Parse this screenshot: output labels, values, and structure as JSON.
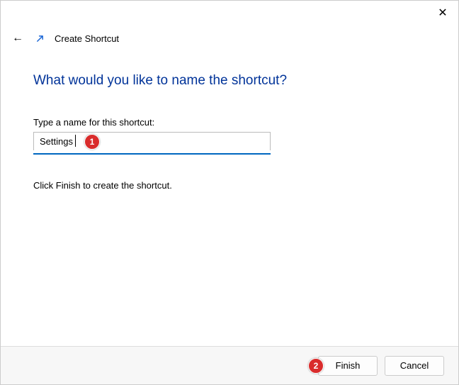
{
  "window": {
    "title": "Create Shortcut"
  },
  "content": {
    "heading": "What would you like to name the shortcut?",
    "field_label": "Type a name for this shortcut:",
    "input_value": "Settings",
    "helper_text": "Click Finish to create the shortcut."
  },
  "footer": {
    "finish_label": "Finish",
    "cancel_label": "Cancel"
  },
  "annotations": {
    "badge1": "1",
    "badge2": "2"
  }
}
